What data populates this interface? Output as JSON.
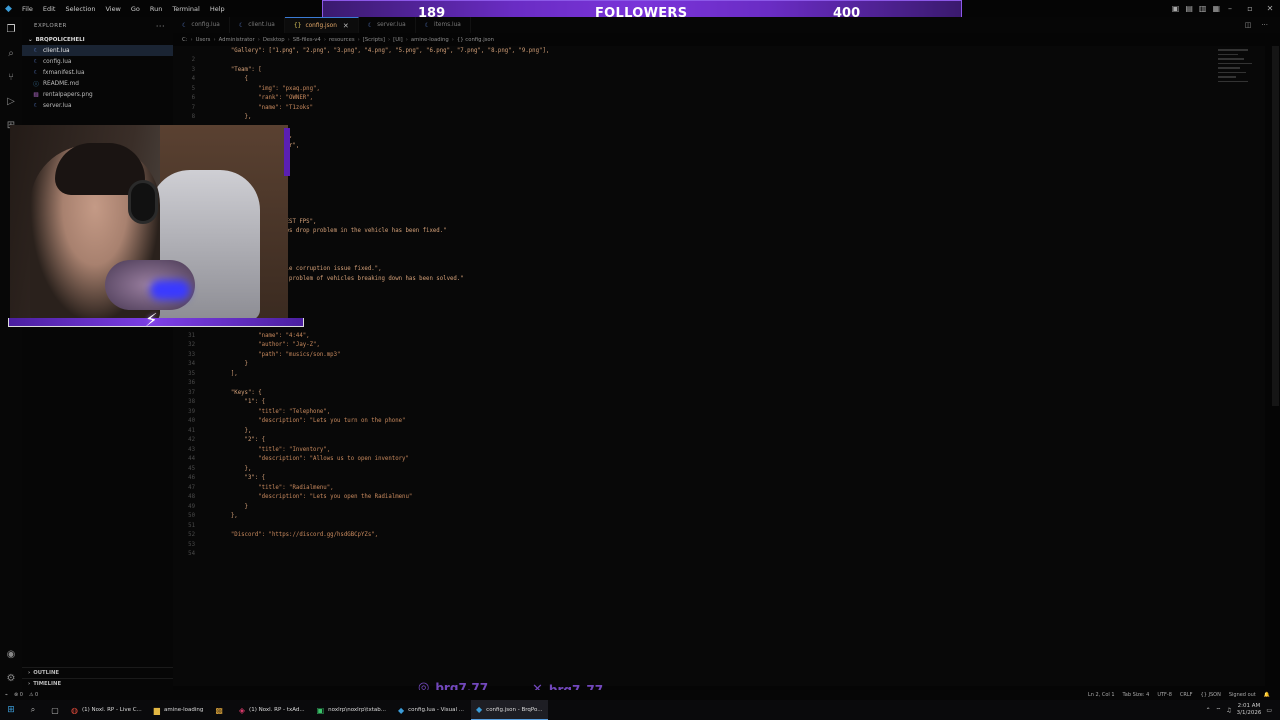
{
  "menu": [
    "File",
    "Edit",
    "Selection",
    "View",
    "Go",
    "Run",
    "Terminal",
    "Help"
  ],
  "followers": {
    "current": "189",
    "label": "FOLLOWERS",
    "goal": "400"
  },
  "sidebar": {
    "title": "EXPLORER",
    "folder": "BRQPOLICEHELI",
    "files": [
      {
        "name": "client.lua",
        "icon": "lua-file-icon",
        "selected": true
      },
      {
        "name": "config.lua",
        "icon": "lua-file-icon",
        "selected": false
      },
      {
        "name": "fxmanifest.lua",
        "icon": "lua-file-icon",
        "selected": false
      },
      {
        "name": "README.md",
        "icon": "markdown-file-icon",
        "selected": false
      },
      {
        "name": "rentalpapers.png",
        "icon": "image-file-icon",
        "selected": false
      },
      {
        "name": "server.lua",
        "icon": "lua-file-icon",
        "selected": false
      }
    ],
    "outline": "OUTLINE",
    "timeline": "TIMELINE"
  },
  "tabs": [
    {
      "label": "config.lua",
      "active": false
    },
    {
      "label": "client.lua",
      "active": false
    },
    {
      "label": "config.json",
      "active": true
    },
    {
      "label": "server.lua",
      "active": false
    },
    {
      "label": "items.lua",
      "active": false
    }
  ],
  "breadcrumb": [
    "C:",
    "Users",
    "Administrator",
    "Desktop",
    "SB-files-v4",
    "resources",
    "[Scripts]",
    "[UI]",
    "amine-loading",
    "{} config.json"
  ],
  "editor": {
    "lines": [
      {
        "n": "",
        "t": "  \"Gallery\": [\"1.png\", \"2.png\", \"3.png\", \"4.png\", \"5.png\", \"6.png\", \"7.png\", \"8.png\", \"9.png\"],",
        "y": 0
      },
      {
        "n": "2",
        "t": "",
        "y": 1
      },
      {
        "n": "3",
        "t": "  \"Team\": [",
        "y": 2
      },
      {
        "n": "4",
        "t": "      {",
        "y": 3
      },
      {
        "n": "5",
        "t": "          \"img\": \"pxaq.png\",",
        "y": 4
      },
      {
        "n": "6",
        "t": "          \"rank\": \"OWNER\",",
        "y": 5
      },
      {
        "n": "7",
        "t": "          \"name\": \"T1zoks\"",
        "y": 6
      },
      {
        "n": "8",
        "t": "      },",
        "y": 7
      },
      {
        "n": "",
        "t": "            vx.png\",",
        "y": 9
      },
      {
        "n": "",
        "t": "            Devloper\",",
        "y": 10
      },
      {
        "n": "",
        "t": "            AMINE\"",
        "y": 11
      },
      {
        "n": "",
        "t": "            \"THE BEST FPS\",",
        "y": 18
      },
      {
        "n": "",
        "t": "            \"The fps drop problem in the vehicle has been fixed.\"",
        "y": 19
      },
      {
        "n": "",
        "t": "            \"Vehicle corruption issue fixed.\",",
        "y": 23
      },
      {
        "n": "",
        "t": "            : \"The problem of vehicles breaking down has been solved.\"",
        "y": 24
      },
      {
        "n": "31",
        "t": "          \"name\": \"4:44\",",
        "y": 30
      },
      {
        "n": "32",
        "t": "          \"author\": \"Jay-Z\",",
        "y": 31
      },
      {
        "n": "33",
        "t": "          \"path\": \"musics/son.mp3\"",
        "y": 32
      },
      {
        "n": "34",
        "t": "      }",
        "y": 33
      },
      {
        "n": "35",
        "t": "  ],",
        "y": 34
      },
      {
        "n": "36",
        "t": "",
        "y": 35
      },
      {
        "n": "37",
        "t": "  \"Keys\": {",
        "y": 36
      },
      {
        "n": "38",
        "t": "      \"1\": {",
        "y": 37
      },
      {
        "n": "39",
        "t": "          \"title\": \"Telephone\",",
        "y": 38
      },
      {
        "n": "40",
        "t": "          \"description\": \"Lets you turn on the phone\"",
        "y": 39
      },
      {
        "n": "41",
        "t": "      },",
        "y": 40
      },
      {
        "n": "42",
        "t": "      \"2\": {",
        "y": 41
      },
      {
        "n": "43",
        "t": "          \"title\": \"Inventory\",",
        "y": 42
      },
      {
        "n": "44",
        "t": "          \"description\": \"Allows us to open inventory\"",
        "y": 43
      },
      {
        "n": "45",
        "t": "      },",
        "y": 44
      },
      {
        "n": "46",
        "t": "      \"3\": {",
        "y": 45
      },
      {
        "n": "47",
        "t": "          \"title\": \"Radialmenu\",",
        "y": 46
      },
      {
        "n": "48",
        "t": "          \"description\": \"Lets you open the Radialmenu\"",
        "y": 47
      },
      {
        "n": "49",
        "t": "      }",
        "y": 48
      },
      {
        "n": "50",
        "t": "  },",
        "y": 49
      },
      {
        "n": "51",
        "t": "",
        "y": 50
      },
      {
        "n": "52",
        "t": "  \"Discord\": \"https://discord.gg/hsdGBCpYZs\",",
        "y": 51
      },
      {
        "n": "53",
        "t": "",
        "y": 52
      },
      {
        "n": "54",
        "t": "",
        "y": 53
      }
    ]
  },
  "statusbar": {
    "left": [
      "⊗ 0",
      "⚠ 0"
    ],
    "position": "Ln 2, Col 1",
    "tabsize": "Tab Size: 4",
    "encoding": "UTF-8",
    "eol": "CRLF",
    "language": "{} JSON",
    "account": "Signed out"
  },
  "socials": [
    {
      "icon": "instagram-icon",
      "handle": "brq7.77"
    },
    {
      "icon": "x-icon",
      "handle": "brq7_77"
    },
    {
      "icon": "tiktok-icon",
      "handle": "brq7_77"
    }
  ],
  "taskbar": {
    "apps": [
      {
        "label": "(1) Noxl. RP - Live C...",
        "icon": "chrome-icon",
        "active": false
      },
      {
        "label": "amine-loading",
        "icon": "folder-icon",
        "active": false
      },
      {
        "label": "",
        "icon": "app-icon",
        "active": false
      },
      {
        "label": "(1) Noxl. RP - txAd...",
        "icon": "browser-icon",
        "active": false
      },
      {
        "label": "noxlrp\\noxlrp\\txtab...",
        "icon": "terminal-icon",
        "active": false
      },
      {
        "label": "config.lua - Visual ...",
        "icon": "vscode-icon",
        "active": false
      },
      {
        "label": "config.json - BrqPo...",
        "icon": "vscode-icon",
        "active": true
      }
    ],
    "time": "2:01 AM",
    "date": "3/1/2026"
  },
  "colors": {
    "accent": "#7a34d9",
    "editor_bg": "#080808",
    "string": "#c98a5e"
  }
}
